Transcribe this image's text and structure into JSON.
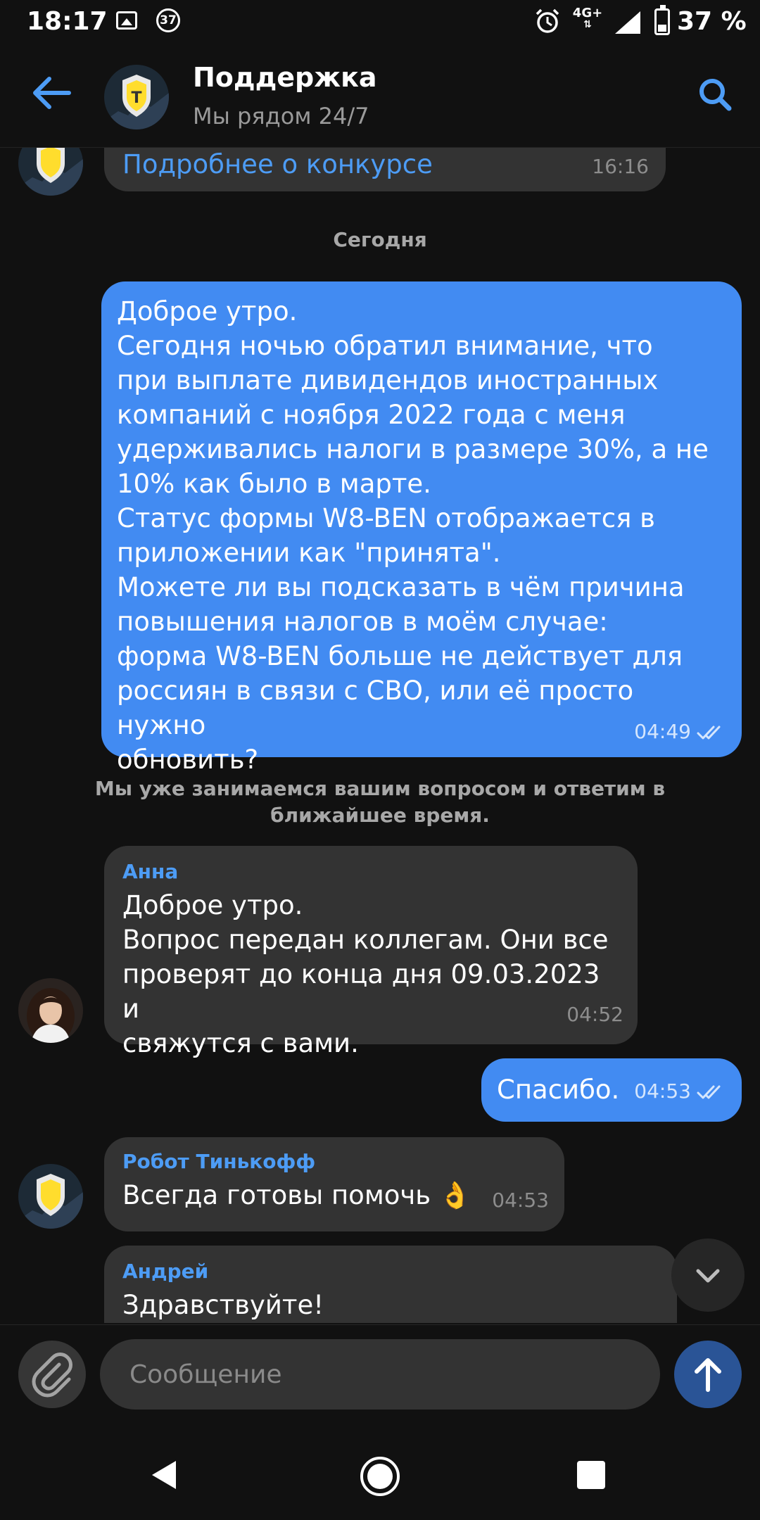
{
  "status_bar": {
    "time": "18:17",
    "notification_count": "37",
    "network": "4G+",
    "battery": "37 %",
    "battery_level": 0.37
  },
  "header": {
    "title": "Поддержка",
    "subtitle": "Мы рядом 24/7"
  },
  "chat": {
    "prev_message": {
      "text": "Подробнее о конкурсе",
      "time": "16:16"
    },
    "date_separator": "Сегодня",
    "msg_user_1": {
      "text": "Доброе утро.\nСегодня ночью обратил внимание, что\nпри выплате дивидендов иностранных\nкомпаний с ноября 2022 года с меня\nудерживались налоги в размере 30%, а не\n10% как было в марте.\nСтатус формы W8-BEN отображается в\nприложении как \"принята\".\nМожете ли вы подсказать в чём причина\nповышения налогов в моём случае:\nформа W8-BEN больше не действует для\nроссиян в связи с СВО, или её просто нужно\nобновить?",
      "time": "04:49"
    },
    "system_note": "Мы уже занимаемся вашим вопросом и ответим в ближайшее время.",
    "msg_anna": {
      "sender": "Анна",
      "text": "Доброе утро.\nВопрос передан коллегам. Они все\nпроверят до конца дня 09.03.2023 и\nсвяжутся с вами.",
      "time": "04:52"
    },
    "msg_user_2": {
      "text": "Спасибо.",
      "time": "04:53"
    },
    "msg_robot": {
      "sender": "Робот Тинькофф",
      "text": "Всегда готовы помочь 👌",
      "time": "04:53"
    },
    "msg_andrey": {
      "sender": "Андрей",
      "text": "Здравствуйте!"
    }
  },
  "composer": {
    "placeholder": "Сообщение"
  },
  "colors": {
    "accent": "#428bf2",
    "incoming_bubble": "#333333",
    "background": "#111111",
    "sender_name": "#4d9cf5"
  },
  "icons": [
    "back-arrow-icon",
    "search-icon",
    "paperclip-icon",
    "send-arrow-icon",
    "chevron-down-icon",
    "double-check-icon"
  ]
}
